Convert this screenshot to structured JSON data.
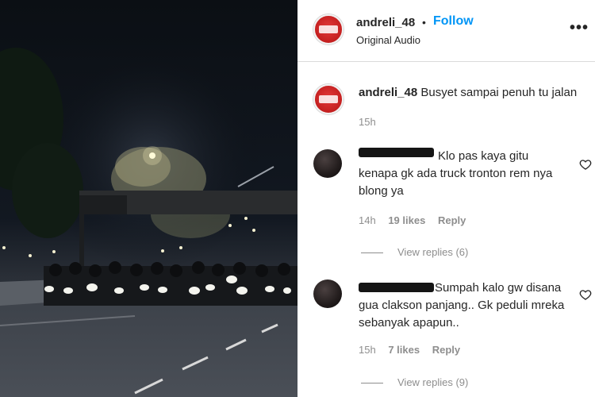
{
  "post": {
    "username": "andreli_48",
    "separator": "•",
    "follow_label": "Follow",
    "audio_label": "Original Audio",
    "more_icon": "more-horizontal-icon"
  },
  "caption": {
    "username": "andreli_48",
    "text": "Busyet sampai penuh tu jalan",
    "time": "15h"
  },
  "comments": [
    {
      "text": "Klo pas kaya gitu kenapa gk ada truck tronton rem nya blong ya",
      "time": "14h",
      "likes": "19 likes",
      "reply_label": "Reply",
      "view_replies": "View replies (6)"
    },
    {
      "text": "Sumpah kalo gw disana gua clakson panjang.. Gk peduli mreka sebanyak apapun..",
      "time": "15h",
      "likes": "7 likes",
      "reply_label": "Reply",
      "view_replies": "View replies (9)"
    }
  ],
  "colors": {
    "follow": "#0095f6",
    "secondary_text": "#8e8e8e",
    "brand_avatar": "#c41f1f"
  }
}
